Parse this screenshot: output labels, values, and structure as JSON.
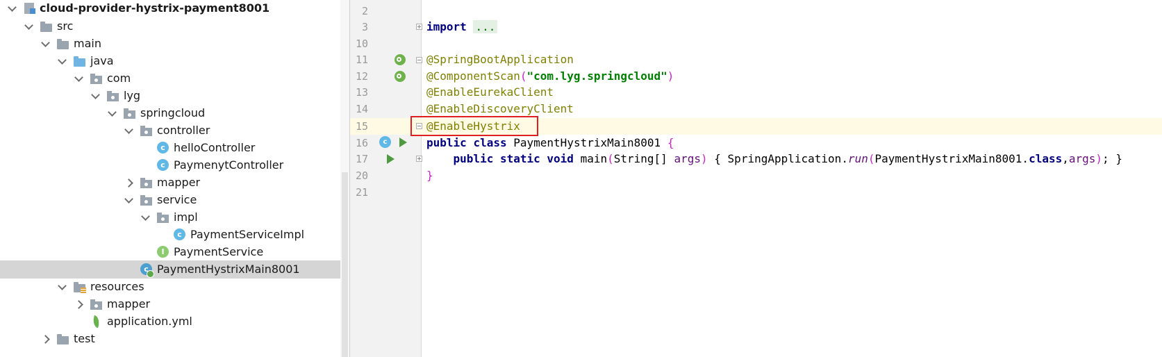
{
  "project_tree": {
    "root": {
      "label": "cloud-provider-hystrix-payment8001"
    },
    "items": [
      {
        "label": "src"
      },
      {
        "label": "main"
      },
      {
        "label": "java"
      },
      {
        "label": "com"
      },
      {
        "label": "lyg"
      },
      {
        "label": "springcloud"
      },
      {
        "label": "controller"
      },
      {
        "label": "helloController"
      },
      {
        "label": "PaymenytController"
      },
      {
        "label": "mapper"
      },
      {
        "label": "service"
      },
      {
        "label": "impl"
      },
      {
        "label": "PaymentServiceImpl"
      },
      {
        "label": "PaymentService"
      },
      {
        "label": "PaymentHystrixMain8001"
      },
      {
        "label": "resources"
      },
      {
        "label": "mapper"
      },
      {
        "label": "application.yml"
      },
      {
        "label": "test"
      }
    ],
    "class_badge": "c",
    "interface_badge": "I"
  },
  "editor": {
    "line_numbers": [
      "2",
      "3",
      "10",
      "11",
      "12",
      "13",
      "14",
      "15",
      "16",
      "17",
      "20",
      "21"
    ],
    "code": {
      "import_kw": "import",
      "import_fold": "...",
      "ann_springboot": "@SpringBootApplication",
      "ann_componentscan": "@ComponentScan",
      "paren_open": "(",
      "componentscan_arg": "\"com.lyg.springcloud\"",
      "paren_close": ")",
      "ann_eureka": "@EnableEurekaClient",
      "ann_discovery": "@EnableDiscoveryClient",
      "ann_hystrix": "@EnableHystrix",
      "kw_public": "public",
      "kw_class": "class",
      "class_name": "PaymentHystrixMain8001",
      "brace_open": "{",
      "kw_static": "static",
      "kw_void": "void",
      "method_name": "main",
      "param_type": "String[]",
      "param_name": "args",
      "body_open": "{",
      "call_class": "SpringApplication",
      "dot": ".",
      "call_method": "run",
      "call_arg_class": "PaymentHystrixMain8001",
      "kw_class_literal": "class",
      "comma": ",",
      "call_arg": "args",
      "semicolon": ";",
      "body_close": "}",
      "brace_close": "}"
    }
  }
}
